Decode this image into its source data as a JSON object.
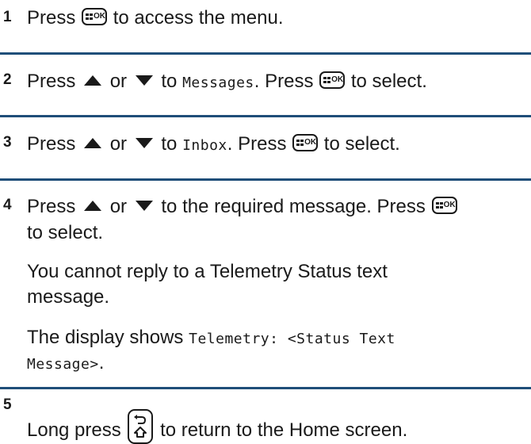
{
  "steps": [
    {
      "number": "1",
      "parts": {
        "a": "Press",
        "b": "to access the menu."
      }
    },
    {
      "number": "2",
      "parts": {
        "a": "Press",
        "b": "or",
        "c": "to",
        "d": "Messages",
        "e": ". Press",
        "f": "to select."
      }
    },
    {
      "number": "3",
      "parts": {
        "a": "Press",
        "b": "or",
        "c": "to",
        "d": "Inbox",
        "e": ". Press",
        "f": "to select."
      }
    },
    {
      "number": "4",
      "parts": {
        "a": "Press",
        "b": "or",
        "c": "to the required message. Press",
        "d": "to select."
      },
      "note_line1": "You cannot reply to a Telemetry Status text",
      "note_line2": "message.",
      "display_prefix": "The display shows",
      "display_mono_line1": "Telemetry: <Status Text",
      "display_mono_line2": "Message>",
      "display_end": "."
    },
    {
      "number": "5",
      "parts": {
        "a": "Long press",
        "b": "to return to the Home screen."
      }
    }
  ],
  "keys": {
    "ok_label": "OK",
    "icons": [
      "menu-ok-key-icon",
      "up-arrow-icon",
      "down-arrow-icon",
      "back-home-key-icon"
    ]
  },
  "colors": {
    "divider": "#1f4e79",
    "text": "#1a1a1a"
  }
}
